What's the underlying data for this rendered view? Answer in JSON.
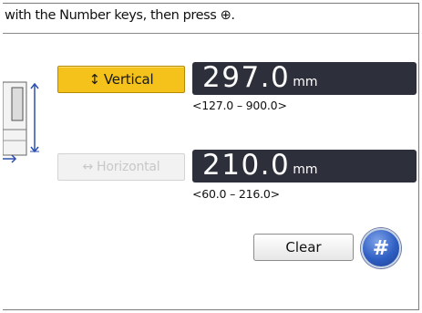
{
  "instruction": "with the Number keys, then press ⊕.",
  "vertical": {
    "label": "Vertical",
    "arrow": "↕",
    "value": "297.0",
    "unit": "mm",
    "range": "<127.0 – 900.0>"
  },
  "horizontal": {
    "label": "Horizontal",
    "arrow": "↔",
    "value": "210.0",
    "unit": "mm",
    "range": "<60.0 – 216.0>"
  },
  "clear_label": "Clear",
  "hash_label": "#",
  "colors": {
    "selected_button": "#f4c21a",
    "value_display": "#2d2f3b",
    "hash_button": "#2f5fc4"
  }
}
